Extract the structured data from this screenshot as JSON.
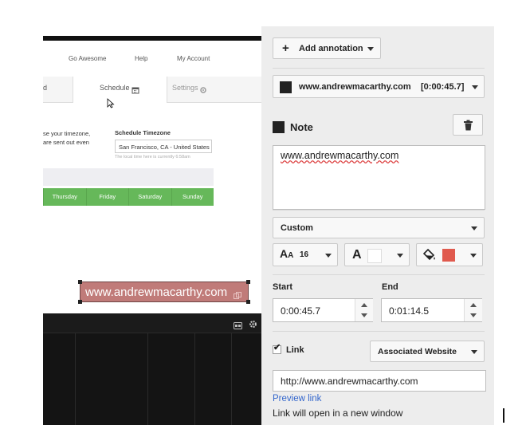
{
  "video": {
    "nav_links": [
      "Go Awesome",
      "Help",
      "My Account"
    ],
    "tabs": [
      {
        "label": "Schedule",
        "icon": "calendar-icon"
      },
      {
        "label": "Settings",
        "icon": "gear-icon"
      }
    ],
    "timezone_text_lines": [
      "se your timezone,",
      "are sent out even"
    ],
    "schedule_timezone_label": "Schedule Timezone",
    "timezone_value": "San Francisco, CA - United States",
    "local_time_note": "The local time here is currently 6:58am",
    "days": [
      "Thursday",
      "Friday",
      "Saturday",
      "Sunday"
    ],
    "tab_stub": "d"
  },
  "annotation_preview": {
    "text": "www.andrewmacarthy.com"
  },
  "panel": {
    "add_annotation_label": "Add annotation",
    "annotation_selector": {
      "text": "www.andrewmacarthy.com",
      "time": "[0:00:45.7]"
    },
    "note_label": "Note",
    "note_text": "www.andrewmacarthy.com",
    "style_select": "Custom",
    "font_size": "16",
    "font_color": "#ffffff",
    "background_color": "#e05a4e",
    "start_label": "Start",
    "start_value": "0:00:45.7",
    "end_label": "End",
    "end_value": "0:01:14.5",
    "link_label": "Link",
    "link_checked": true,
    "link_type": "Associated Website",
    "link_url": "http://www.andrewmacarthy.com",
    "preview_link_label": "Preview link",
    "link_note": "Link will open in a new window"
  }
}
